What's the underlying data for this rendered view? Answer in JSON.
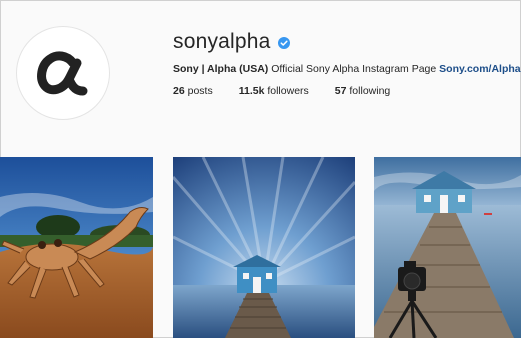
{
  "profile": {
    "username": "sonyalpha",
    "verified": true,
    "avatar_icon": "sony-alpha-logo-icon",
    "bio_name": "Sony | Alpha (USA)",
    "bio_text": "Official Sony Alpha Instagram Page",
    "bio_link": "Sony.com/Alpha"
  },
  "stats": [
    {
      "value": "26",
      "label": "posts"
    },
    {
      "value": "11.5k",
      "label": "followers"
    },
    {
      "value": "57",
      "label": "following"
    }
  ],
  "posts": [
    {
      "subject": "crab-on-sand"
    },
    {
      "subject": "boathouse-long-exposure"
    },
    {
      "subject": "boathouse-with-camera-tripod"
    }
  ],
  "colors": {
    "verified_badge": "#3897f0",
    "link": "#1d4e89"
  }
}
